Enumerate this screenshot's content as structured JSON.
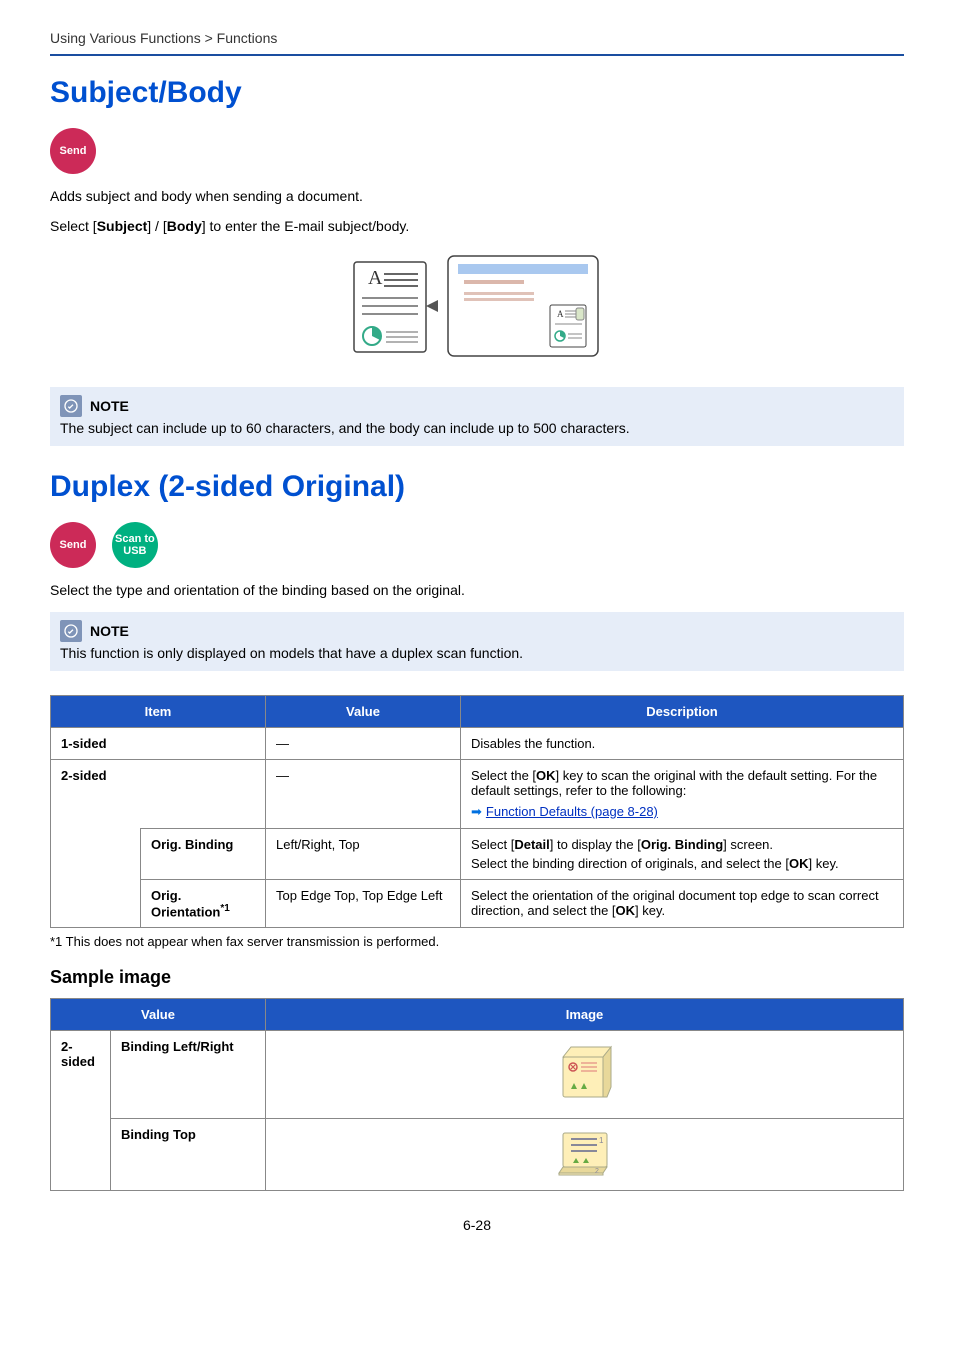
{
  "breadcrumb": "Using Various Functions > Functions",
  "section1": {
    "title": "Subject/Body",
    "badges": {
      "send": "Send"
    },
    "p1_pre": "Adds subject and body when sending a document.",
    "p2_pre": "Select [",
    "p2_b1": "Subject",
    "p2_mid": "] / [",
    "p2_b2": "Body",
    "p2_post": "] to enter the E-mail subject/body.",
    "note_label": "NOTE",
    "note_body": "The subject can include up to 60 characters, and the body can include up to 500 characters."
  },
  "section2": {
    "title": "Duplex (2-sided Original)",
    "badges": {
      "send": "Send",
      "scan": "Scan to USB"
    },
    "p1": "Select the type and orientation of the binding based on the original.",
    "note_label": "NOTE",
    "note_body": "This function is only displayed on models that have a duplex scan function.",
    "table_headers": {
      "item": "Item",
      "value": "Value",
      "desc": "Description"
    },
    "rows": {
      "r1": {
        "item": "1-sided",
        "value": "—",
        "desc": "Disables the function."
      },
      "r2": {
        "item": "2-sided",
        "value": "—",
        "desc_pre": "Select the [",
        "desc_b1": "OK",
        "desc_mid": "] key to scan the original with the default setting. For the default settings, refer to the following:",
        "link": "Function Defaults (page 8-28)"
      },
      "r3": {
        "item": "Orig. Binding",
        "value": "Left/Right, Top",
        "d1_pre": "Select [",
        "d1_b1": "Detail",
        "d1_mid": "] to display the [",
        "d1_b2": "Orig. Binding",
        "d1_post": "] screen.",
        "d2_pre": "Select the binding direction of originals, and select the [",
        "d2_b1": "OK",
        "d2_post": "] key."
      },
      "r4": {
        "item_pre": "Orig. Orientation",
        "item_sup": "*1",
        "value": "Top Edge Top, Top Edge Left",
        "desc_pre": "Select the orientation of the original document top edge to scan correct direction, and select the [",
        "desc_b1": "OK",
        "desc_post": "] key."
      }
    },
    "footnote": "*1   This does not appear when fax server transmission is performed.",
    "sample_heading": "Sample image",
    "sample_headers": {
      "value": "Value",
      "image": "Image"
    },
    "sample_rows": {
      "r1": {
        "main": "2-sided",
        "sub": "Binding Left/Right"
      },
      "r2": {
        "sub": "Binding Top"
      }
    }
  },
  "page_num": "6-28"
}
